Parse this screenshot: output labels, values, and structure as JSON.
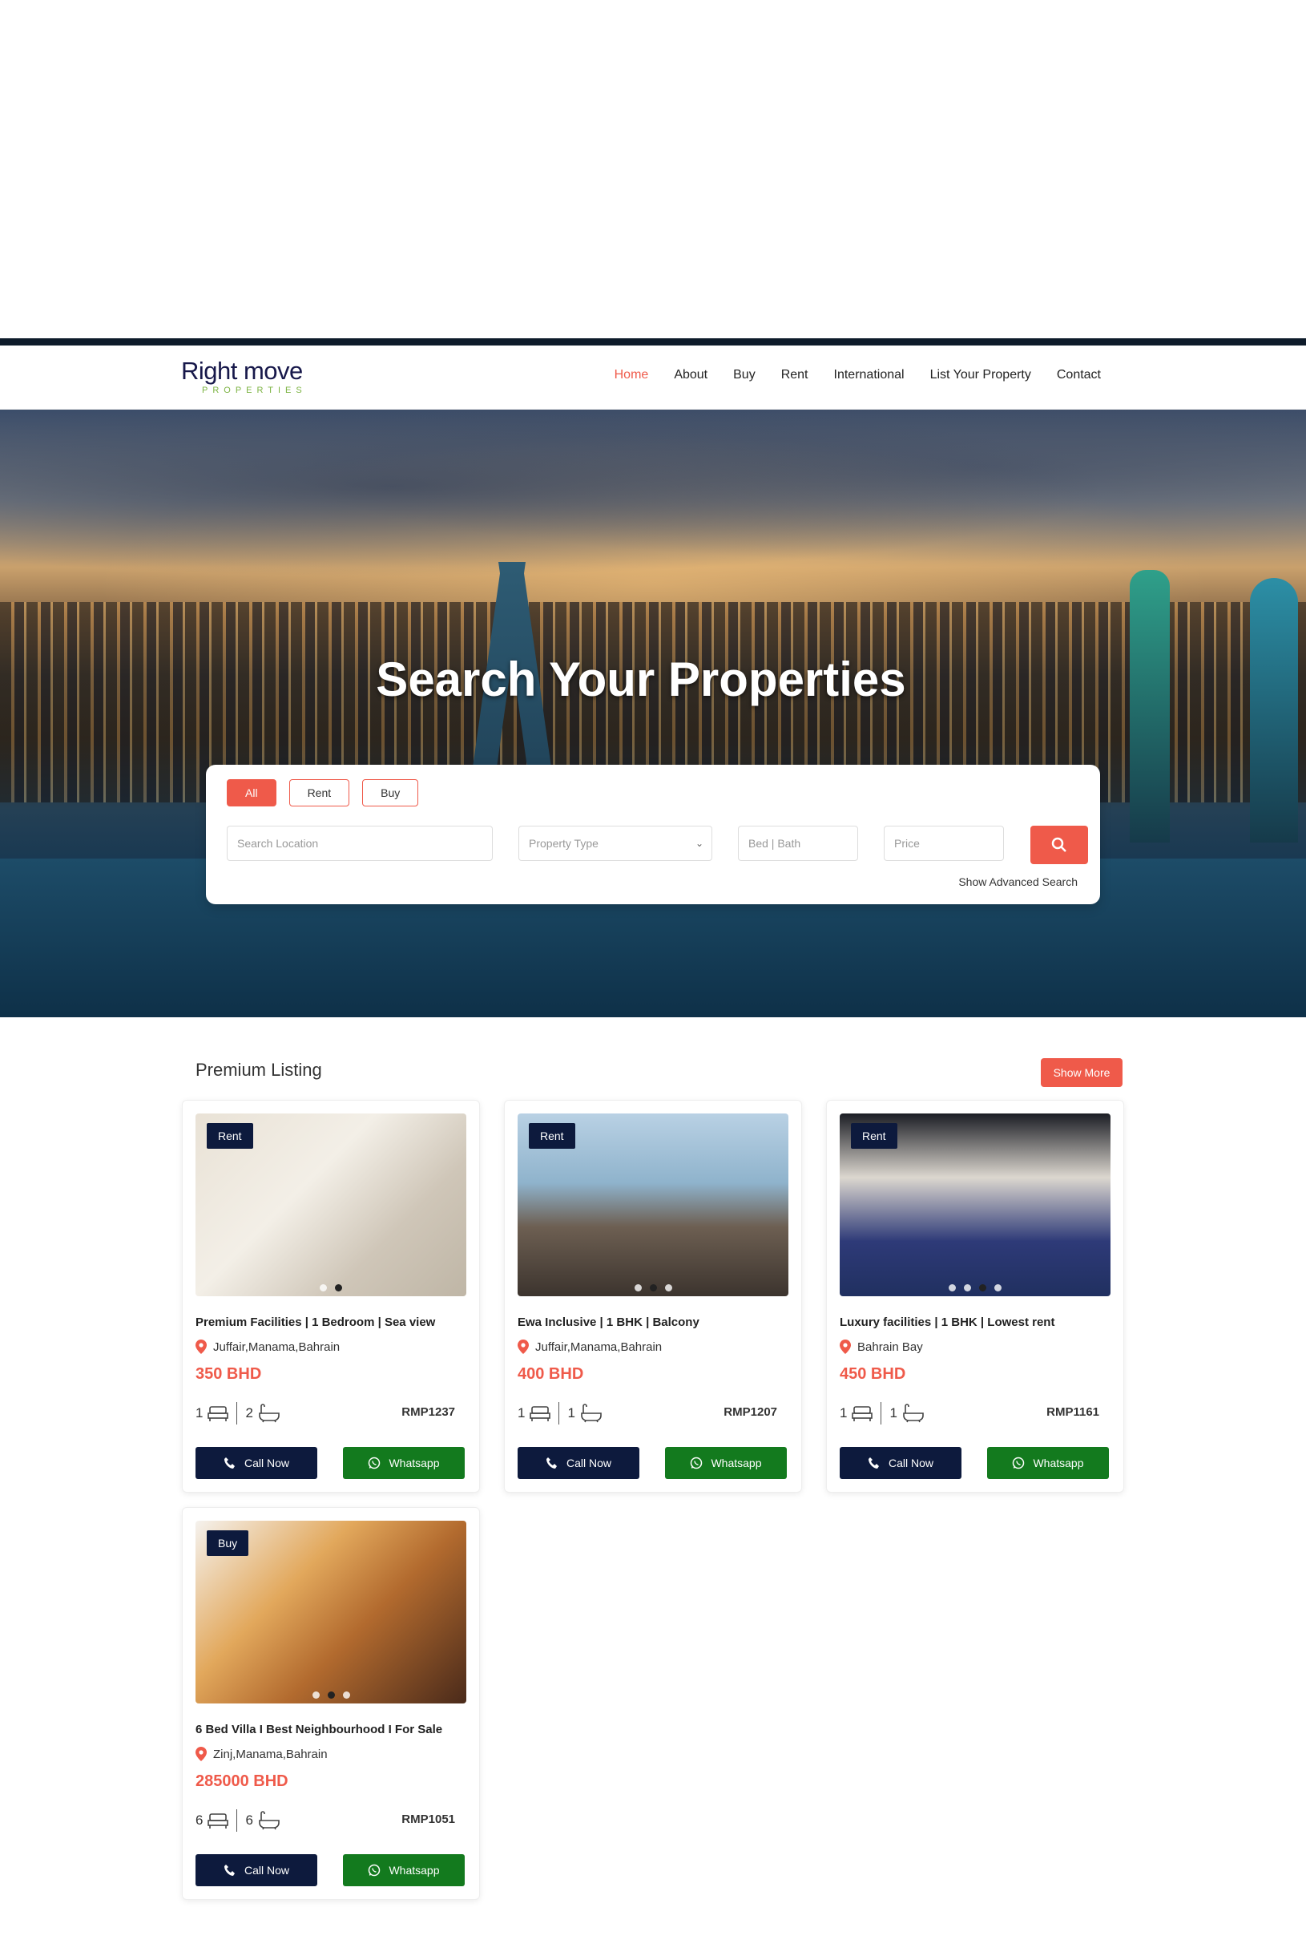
{
  "logo": {
    "main": "Right move",
    "sub": "PROPERTIES"
  },
  "nav": [
    "Home",
    "About",
    "Buy",
    "Rent",
    "International",
    "List Your Property",
    "Contact"
  ],
  "hero": {
    "title": "Search Your Properties"
  },
  "search": {
    "tabs": [
      "All",
      "Rent",
      "Buy"
    ],
    "location_placeholder": "Search Location",
    "type_placeholder": "Property Type",
    "bedbath_placeholder": "Bed | Bath",
    "price_placeholder": "Price",
    "advanced": "Show Advanced Search"
  },
  "listing": {
    "title": "Premium Listing",
    "show_more": "Show More",
    "call_label": "Call Now",
    "wa_label": "Whatsapp",
    "cards": [
      {
        "badge": "Rent",
        "title": "Premium Facilities | 1 Bedroom | Sea view",
        "location": "Juffair,Manama,Bahrain",
        "price": "350 BHD",
        "beds": "1",
        "baths": "2",
        "ref": "RMP1237"
      },
      {
        "badge": "Rent",
        "title": "Ewa Inclusive | 1 BHK | Balcony",
        "location": "Juffair,Manama,Bahrain",
        "price": "400 BHD",
        "beds": "1",
        "baths": "1",
        "ref": "RMP1207"
      },
      {
        "badge": "Rent",
        "title": "Luxury facilities | 1 BHK | Lowest rent",
        "location": "Bahrain Bay",
        "price": "450 BHD",
        "beds": "1",
        "baths": "1",
        "ref": "RMP1161"
      },
      {
        "badge": "Buy",
        "title": "6 Bed Villa I Best Neighbourhood I For Sale",
        "location": "Zinj,Manama,Bahrain",
        "price": "285000 BHD",
        "beds": "6",
        "baths": "6",
        "ref": "RMP1051"
      }
    ]
  },
  "colors": {
    "accent": "#ef5a4a",
    "navy": "#0d1a3d",
    "whatsapp": "#137a1e"
  }
}
